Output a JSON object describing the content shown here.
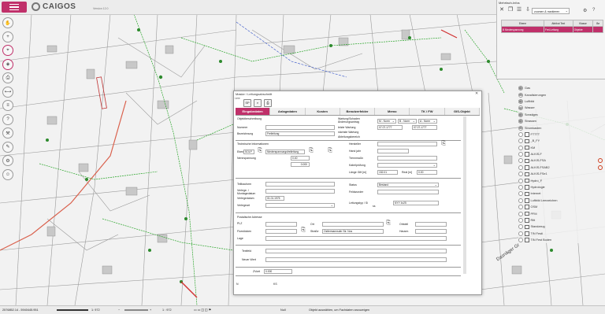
{
  "header": {
    "logo_text": "CAIGOS",
    "version": "Version 12.0"
  },
  "right_panel": {
    "title": "Mehrfach-Infos",
    "select_value": "zoomen & markieren",
    "table": {
      "headers": [
        "Ebene",
        "Attribut Text",
        "Klasse",
        "Be"
      ],
      "rows": [
        [
          "B Niederspannung",
          "Frei-Leitung",
          "Objekte",
          ""
        ]
      ]
    }
  },
  "layers": [
    {
      "label": "Gas",
      "type": "folder"
    },
    {
      "label": "Kanalisierungen",
      "type": "folder"
    },
    {
      "label": "Luftbild",
      "type": "folder"
    },
    {
      "label": "Wasser",
      "type": "folder"
    },
    {
      "label": "Sonstiges",
      "type": "folder"
    },
    {
      "label": "Strassen",
      "type": "folder"
    },
    {
      "label": "Stromkasten",
      "type": "folder"
    },
    {
      "label": "FTTTT",
      "type": "layer"
    },
    {
      "label": "_B_FY",
      "type": "layer"
    },
    {
      "label": "KM",
      "type": "layer"
    },
    {
      "label": "ALKIS-F",
      "type": "layer"
    },
    {
      "label": "ALKIS-FSA",
      "type": "layer",
      "warn": true
    },
    {
      "label": "ALKIS-FSAB2",
      "type": "layer",
      "warn": true
    },
    {
      "label": "ALKIS-FSe1",
      "type": "layer"
    },
    {
      "label": "Hydro_F",
      "type": "layer"
    },
    {
      "label": "Hydrologie",
      "type": "layer"
    },
    {
      "label": "Internet",
      "type": "layer"
    },
    {
      "label": "Luftbild Leerzeichen",
      "type": "layer"
    },
    {
      "label": "OSM",
      "type": "layer"
    },
    {
      "label": "PFM",
      "type": "layer"
    },
    {
      "label": "Ritt",
      "type": "layer"
    },
    {
      "label": "Standzeug",
      "type": "layer"
    },
    {
      "label": "TIN Festi",
      "type": "layer"
    },
    {
      "label": "TIN Fest Boden",
      "type": "layer"
    }
  ],
  "map_labels": [
    "Dasnäger Gr"
  ],
  "statusbar": {
    "coords": "2576852.14 - 5940445.951",
    "scale": "1: 972",
    "page": "1 : 972",
    "mode": "Null",
    "hint": "Objekt auswählen, um Fachdaten anzuzeigen"
  },
  "dialog": {
    "title": "Maske / Leitungsabschnitt",
    "mini_label": "Linie",
    "tabs": [
      "Eingabedaten",
      "Anlagedaten",
      "Kosten",
      "Benutzerfelder",
      "Memo",
      "TK / FW",
      "GIS-Objekt"
    ],
    "active_tab": 0,
    "sec1": {
      "objektbeschreibung": "Objektbeschreibung",
      "nummer": "Nummer",
      "bezeichnung": "Bezeichnung",
      "bezeichnung_value": "Freileitung",
      "wartung": "Wartung/Schaden Änderungsantrag",
      "wartung_sel1": "M - Norm",
      "wartung_sel2": "B - Norm",
      "wartung_sel3": "A - Norm",
      "letzte": "letzte Wartung",
      "letzte_value": "07.07.1777",
      "naechste": "nächste Wartung",
      "naechste_value": "07.07.1777",
      "ableitung": "Ableitungsbereich"
    },
    "sec2": {
      "header": "Technische Informationen",
      "ebene": "Ebene",
      "ebene_value": "SOLP",
      "ebene_value2": "Niederspannungsfreileitung",
      "nennspannung": "Nennspannung",
      "nenn_value1": "0.40",
      "nenn_value2": "0.000",
      "hersteller": "Hersteller",
      "hand_jahr": "Hand jahr",
      "trennmaske": "Trennmaßn",
      "kabeltyp": "Kabelprüfung",
      "laenge": "Länge Gift [m]",
      "laenge_value": "152.01",
      "real": "Real [m]",
      "real_value": "0.00"
    },
    "sec3": {
      "teilbauform": "Teilbauform",
      "verlege": "Verlege- / Montagedatum",
      "verlegedatum": "Verlegedatum",
      "verlegedatum_value": "01.01.1975",
      "verlegeart": "Verlegeart",
      "status": "Status",
      "status_value": "Bestand",
      "feldwunder": "Feldwunder",
      "leitungstyp": "Leitungstyp / Si",
      "leitungstyp_value": "NYY 4x25",
      "leitungstyp_prefix": "ss"
    },
    "sec4": {
      "header": "Postalische Adresse",
      "plz": "PLZ",
      "ort": "Ort",
      "ortsteil": "Ortsteil",
      "flurstuecke": "Flurstücken",
      "strasse": "Straße",
      "strasse_value": "Ostlermannsder Str. Nos",
      "hausnr": "Hausnr.",
      "lage": "Lage"
    },
    "sec5": {
      "textfeld": "Textfeld",
      "neuer_wert": "Neuer Wert",
      "zvoet": "ZVoet",
      "zvoet_value": "0.000"
    },
    "footer": {
      "left": "N",
      "right": "KS"
    }
  }
}
